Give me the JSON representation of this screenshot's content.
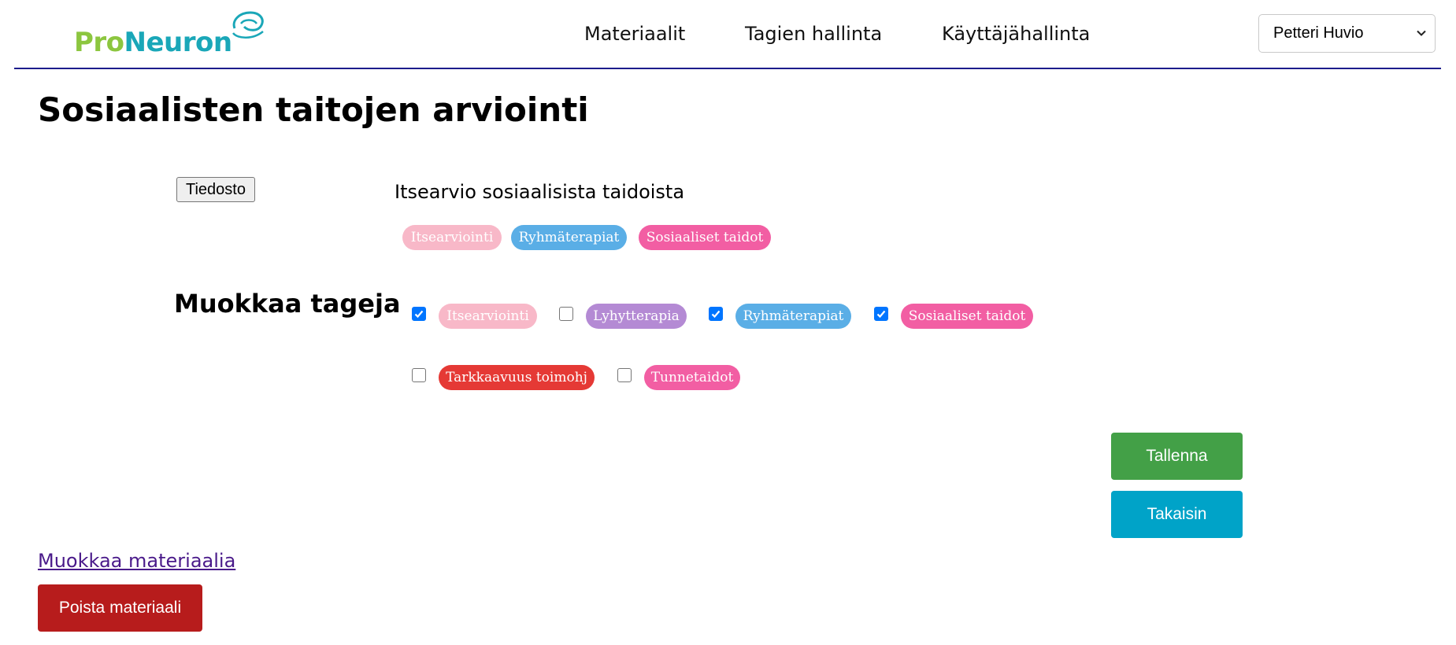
{
  "header": {
    "logo": {
      "part1": "Pro",
      "part2": "Neuron"
    },
    "nav": [
      {
        "label": "Materiaalit"
      },
      {
        "label": "Tagien hallinta"
      },
      {
        "label": "Käyttäjähallinta"
      }
    ],
    "user_select": {
      "value": "Petteri Huvio",
      "icon": "chevron-down-icon"
    }
  },
  "page": {
    "title": "Sosiaalisten taitojen arviointi"
  },
  "material": {
    "file_button_label": "Tiedosto",
    "name": "Itsearvio sosiaalisista taidoista",
    "current_tags": [
      {
        "label": "Itsearviointi",
        "color": "#f8b8c8"
      },
      {
        "label": "Ryhmäterapiat",
        "color": "#5aaee6"
      },
      {
        "label": "Sosiaaliset taidot",
        "color": "#f25ea3"
      }
    ]
  },
  "edit_tags": {
    "title": "Muokkaa tageja",
    "tags": [
      {
        "label": "Itsearviointi",
        "checked": true,
        "color": "#f8b8c8"
      },
      {
        "label": "Lyhytterapia",
        "checked": false,
        "color": "#b48ad4"
      },
      {
        "label": "Ryhmäterapiat",
        "checked": true,
        "color": "#5aaee6"
      },
      {
        "label": "Sosiaaliset taidot",
        "checked": true,
        "color": "#f25ea3"
      },
      {
        "label": "Tarkkaavuus toimohj",
        "checked": false,
        "color": "#e53935"
      },
      {
        "label": "Tunnetaidot",
        "checked": false,
        "color": "#f25ea3"
      }
    ]
  },
  "actions": {
    "save_label": "Tallenna",
    "save_color": "#43a047",
    "back_label": "Takaisin",
    "back_color": "#00a3c8",
    "edit_link": "Muokkaa materiaalia",
    "delete_label": "Poista materiaali",
    "delete_color": "#b71c1c"
  }
}
